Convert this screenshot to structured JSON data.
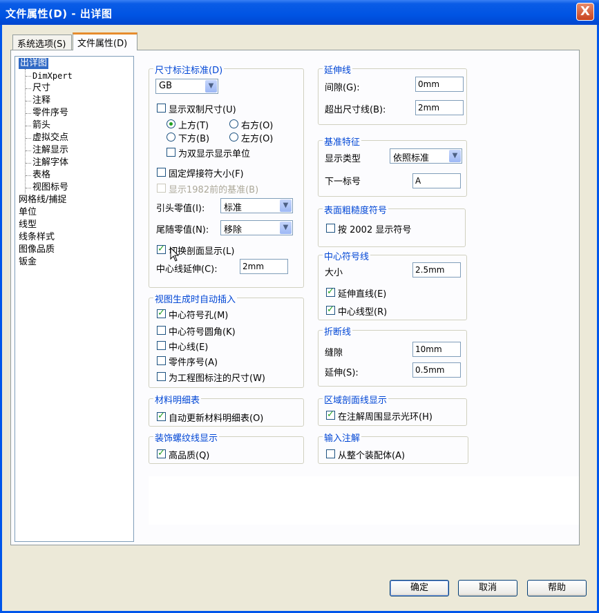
{
  "window": {
    "title": "文件属性(D) - 出详图",
    "close_label": "X"
  },
  "tabs": [
    {
      "label": "系统选项(S)"
    },
    {
      "label": "文件属性(D)"
    }
  ],
  "tree": {
    "items": [
      {
        "label": "出详图"
      },
      {
        "label": "DimXpert"
      },
      {
        "label": "尺寸"
      },
      {
        "label": "注释"
      },
      {
        "label": "零件序号"
      },
      {
        "label": "箭头"
      },
      {
        "label": "虚拟交点"
      },
      {
        "label": "注解显示"
      },
      {
        "label": "注解字体"
      },
      {
        "label": "表格"
      },
      {
        "label": "视图标号"
      },
      {
        "label": "网格线/捕捉"
      },
      {
        "label": "单位"
      },
      {
        "label": "线型"
      },
      {
        "label": "线条样式"
      },
      {
        "label": "图像品质"
      },
      {
        "label": "钣金"
      }
    ]
  },
  "dim_standard": {
    "title": "尺寸标注标准(D)",
    "standard": "GB",
    "dual_dim": {
      "label": "显示双制尺寸(U)",
      "checked": false
    },
    "radio_top": "上方(T)",
    "radio_bottom": "下方(B)",
    "radio_right": "右方(O)",
    "radio_left": "左方(O)",
    "dual_units": {
      "label": "为双显示显示单位",
      "checked": false
    },
    "fixed_weld": {
      "label": "固定焊接符大小(F)",
      "checked": false
    },
    "show_1982": {
      "label": "显示1982前的基准(B)",
      "checked": false
    },
    "leading_zero_label": "引头零值(I):",
    "leading_zero_value": "标准",
    "trailing_zero_label": "尾随零值(N):",
    "trailing_zero_value": "移除",
    "toggle_section": {
      "label": "切换剖面显示(L)",
      "checked": true
    },
    "centerline_ext_label": "中心线延伸(C):",
    "centerline_ext_value": "2mm"
  },
  "auto_insert": {
    "title": "视图生成时自动插入",
    "items": [
      {
        "label": "中心符号孔(M)",
        "checked": true
      },
      {
        "label": "中心符号圆角(K)",
        "checked": false
      },
      {
        "label": "中心线(E)",
        "checked": false
      },
      {
        "label": "零件序号(A)",
        "checked": false
      },
      {
        "label": "为工程图标注的尺寸(W)",
        "checked": false
      }
    ]
  },
  "bom": {
    "title": "材料明细表",
    "auto_update": {
      "label": "自动更新材料明细表(O)",
      "checked": true
    }
  },
  "thread": {
    "title": "装饰螺纹线显示",
    "high_quality": {
      "label": "高品质(Q)",
      "checked": true
    }
  },
  "extension": {
    "title": "延伸线",
    "gap_label": "间隙(G):",
    "gap_value": "0mm",
    "beyond_label": "超出尺寸线(B):",
    "beyond_value": "2mm"
  },
  "datum": {
    "title": "基准特征",
    "display_type_label": "显示类型",
    "display_type_value": "依照标准",
    "next_label_label": "下一标号",
    "next_label_value": "A"
  },
  "surface": {
    "title": "表面粗糙度符号",
    "show2002": {
      "label": "按 2002 显示符号",
      "checked": false
    }
  },
  "center_mark": {
    "title": "中心符号线",
    "size_label": "大小",
    "size_value": "2.5mm",
    "extend": {
      "label": "延伸直线(E)",
      "checked": true
    },
    "center_linetype": {
      "label": "中心线型(R)",
      "checked": true
    }
  },
  "break_line": {
    "title": "折断线",
    "gap_label": "缝隙",
    "gap_value": "10mm",
    "ext_label": "延伸(S):",
    "ext_value": "0.5mm"
  },
  "area_hatch": {
    "title": "区域剖面线显示",
    "halo": {
      "label": "在注解周围显示光环(H)",
      "checked": true
    }
  },
  "input_annotation": {
    "title": "输入注解",
    "from_assembly": {
      "label": "从整个装配体(A)",
      "checked": false
    }
  },
  "buttons": {
    "ok": "确定",
    "cancel": "取消",
    "help": "帮助"
  }
}
